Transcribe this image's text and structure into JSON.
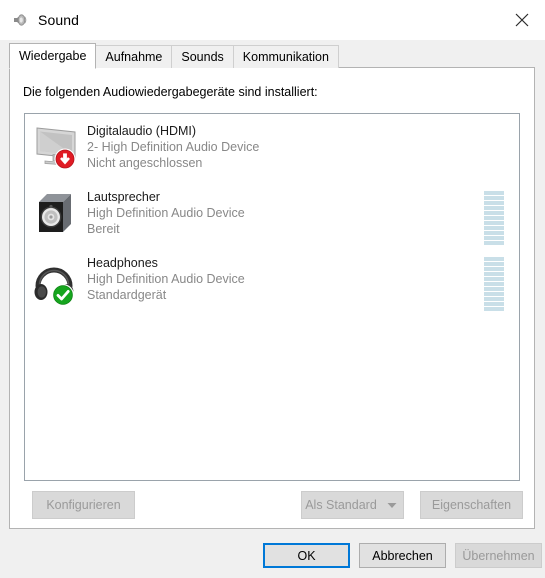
{
  "window": {
    "title": "Sound",
    "icon": "speaker-icon",
    "close_label": "✕"
  },
  "tabs": [
    {
      "label": "Wiedergabe",
      "active": true
    },
    {
      "label": "Aufnahme",
      "active": false
    },
    {
      "label": "Sounds",
      "active": false
    },
    {
      "label": "Kommunikation",
      "active": false
    }
  ],
  "panel": {
    "instruction": "Die folgenden Audiowiedergabegeräte sind installiert:"
  },
  "devices": [
    {
      "name": "Digitalaudio (HDMI)",
      "driver": "2- High Definition Audio Device",
      "status": "Nicht angeschlossen",
      "icon": "monitor-icon",
      "badge": "red-down-arrow-badge",
      "meter_segments": 0,
      "meter_visible": false
    },
    {
      "name": "Lautsprecher",
      "driver": "High Definition Audio Device",
      "status": "Bereit",
      "icon": "speaker-box-icon",
      "badge": "none",
      "meter_segments": 11,
      "meter_visible": true
    },
    {
      "name": "Headphones",
      "driver": "High Definition Audio Device",
      "status": "Standardgerät",
      "icon": "headphones-icon",
      "badge": "green-check-badge",
      "meter_segments": 11,
      "meter_visible": true
    }
  ],
  "panel_buttons": {
    "configure": "Konfigurieren",
    "set_default": "Als Standard",
    "properties": "Eigenschaften"
  },
  "dialog_buttons": {
    "ok": "OK",
    "cancel": "Abbrechen",
    "apply": "Übernehmen"
  },
  "colors": {
    "accent": "#0078d7",
    "meter_segment": "#c9dfe8",
    "badge_red": "#e01b24",
    "badge_green": "#16a51e",
    "disabled_text": "#9a9a9a",
    "secondary_text": "#888888"
  }
}
